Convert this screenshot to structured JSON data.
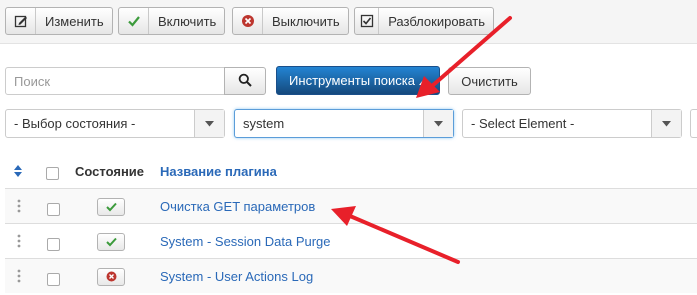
{
  "toolbar": {
    "edit_label": "Изменить",
    "enable_label": "Включить",
    "disable_label": "Выключить",
    "unlock_label": "Разблокировать"
  },
  "search": {
    "placeholder": "Поиск",
    "tools_label": "Инструменты поиска",
    "clear_label": "Очистить"
  },
  "filters": {
    "state_value": "- Выбор состояния -",
    "folder_value": "system",
    "element_value": "- Select Element -"
  },
  "table": {
    "col_status": "Состояние",
    "col_name": "Название плагина",
    "rows": [
      {
        "name": "Очистка GET параметров",
        "status": "enabled"
      },
      {
        "name": "System - Session Data Purge",
        "status": "enabled"
      },
      {
        "name": "System - User Actions Log",
        "status": "disabled"
      }
    ]
  },
  "colors": {
    "accent_blue": "#1c6bb8",
    "link": "#2a69b8",
    "annotation_arrow": "#e8202a",
    "enabled_green": "#3c9b3c",
    "disabled_red": "#bd362f"
  }
}
